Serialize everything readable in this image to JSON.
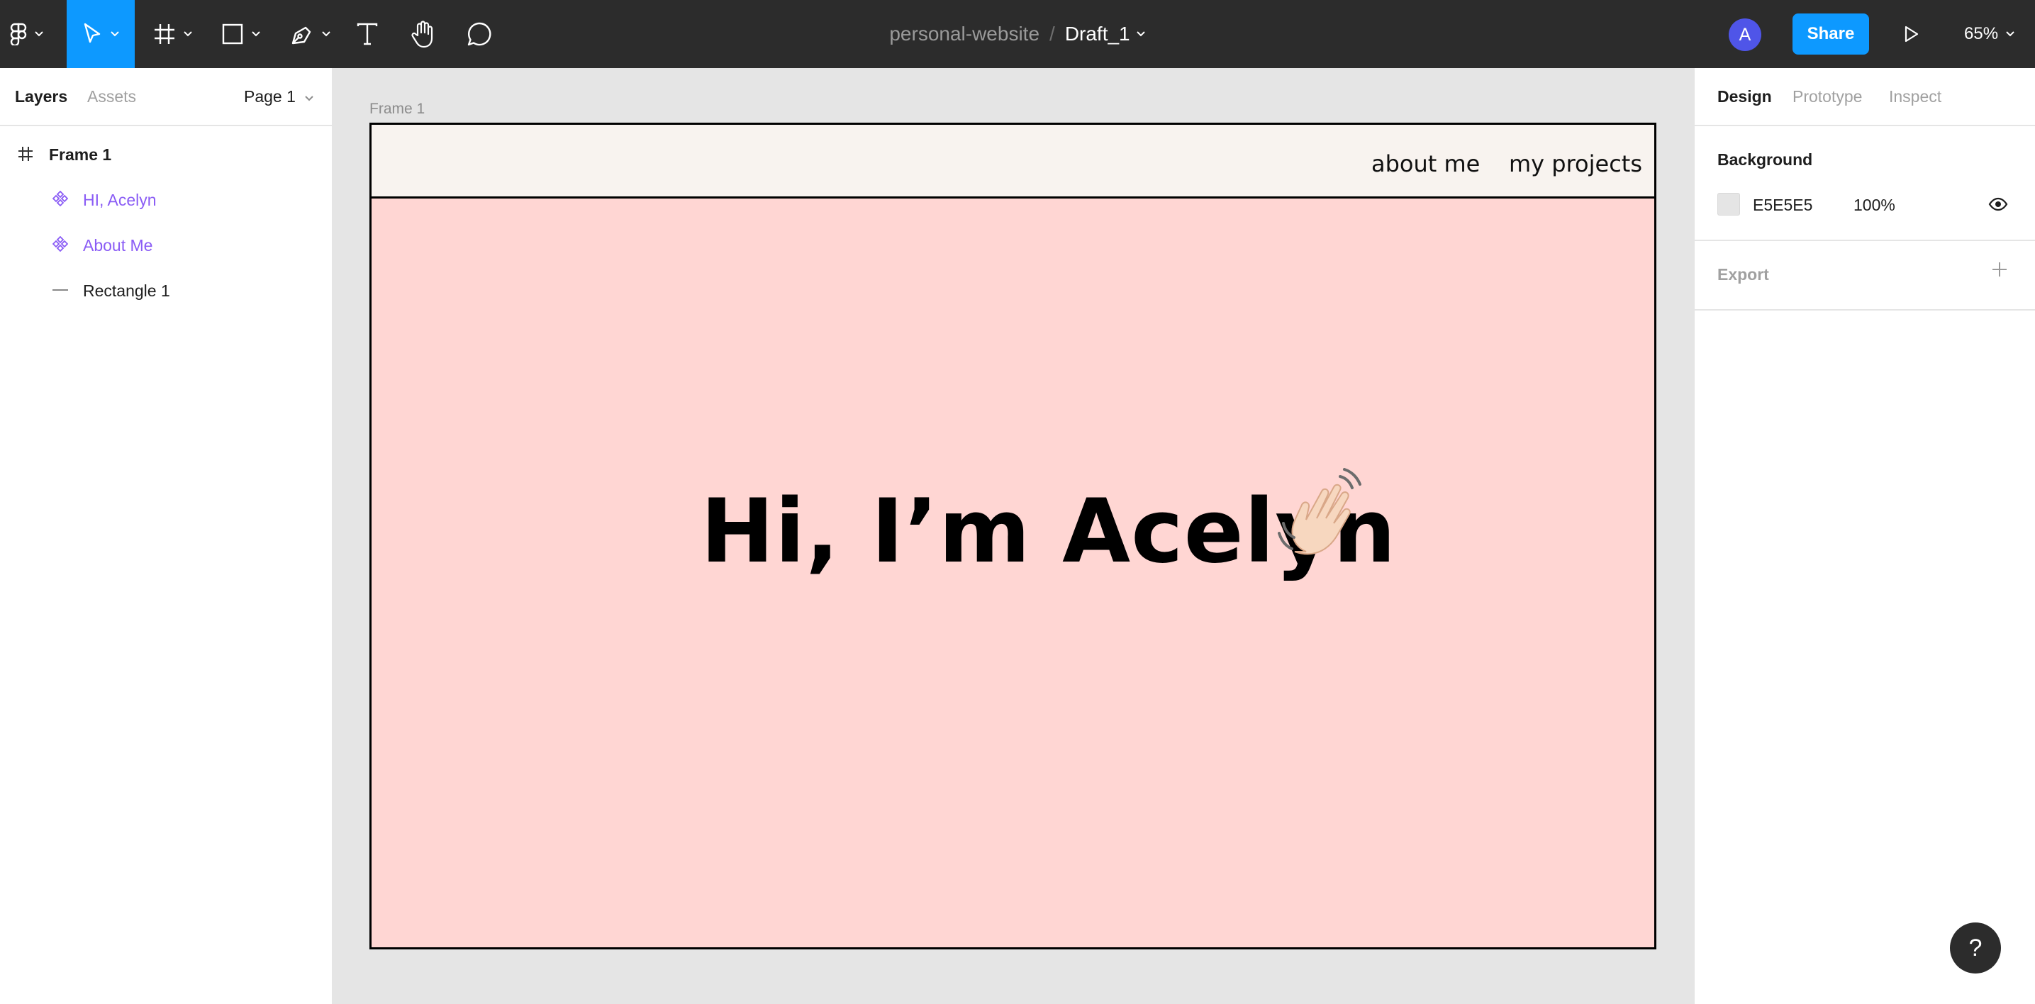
{
  "toolbar": {
    "project_name": "personal-website",
    "separator": "/",
    "draft_name": "Draft_1",
    "avatar_initial": "A",
    "share_label": "Share",
    "zoom": "65%"
  },
  "left_panel": {
    "tabs": [
      "Layers",
      "Assets"
    ],
    "page": "Page 1",
    "layers": [
      {
        "name": "Frame 1",
        "icon": "frame-icon"
      },
      {
        "name": "HI, Acelyn",
        "icon": "component-instance-icon"
      },
      {
        "name": "About Me",
        "icon": "component-instance-icon"
      },
      {
        "name": "Rectangle 1",
        "icon": "line-icon"
      }
    ]
  },
  "right_panel": {
    "tabs": [
      "Design",
      "Prototype",
      "Inspect"
    ],
    "background": {
      "title": "Background",
      "hex": "E5E5E5",
      "opacity": "100%"
    },
    "export_title": "Export"
  },
  "canvas": {
    "frame_label": "Frame 1",
    "nav_links": [
      "about me",
      "my projects"
    ],
    "hero_title": "Hi, I’m Acelyn"
  },
  "help_label": "?",
  "colors": {
    "toolbar_bg": "#2c2c2c",
    "accent_blue": "#0d99ff",
    "component_purple": "#8a5cf5",
    "frame_bg": "#ffd6d3",
    "navbar_bg": "#f8f3ef",
    "canvas_bg": "#e5e5e5"
  }
}
